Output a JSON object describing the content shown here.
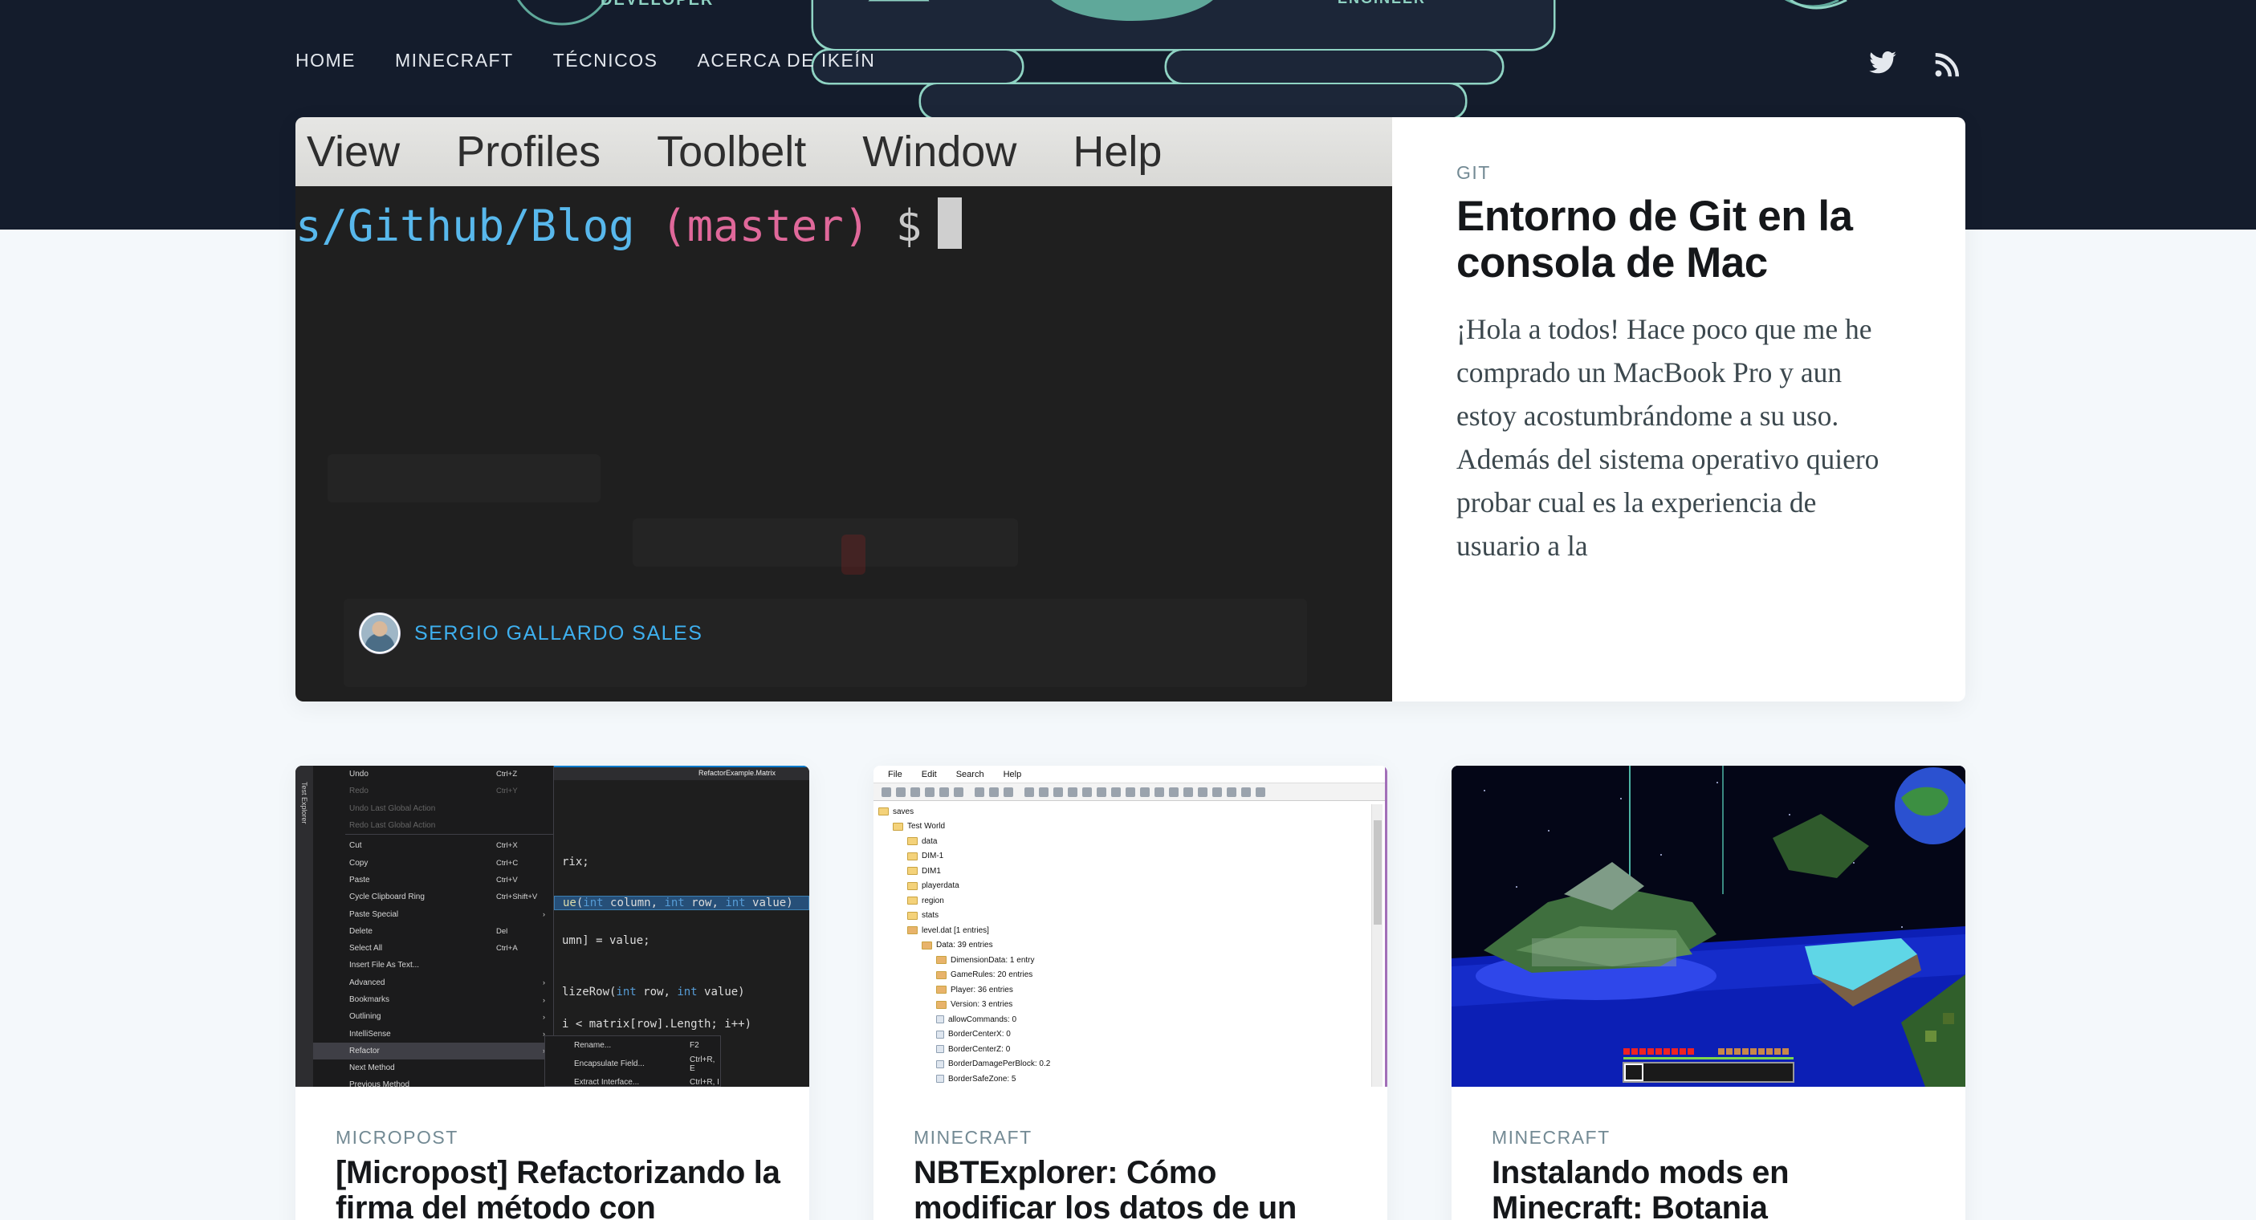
{
  "nav": {
    "items": [
      "Home",
      "Minecraft",
      "Técnicos",
      "Acerca de Ikeín"
    ]
  },
  "social": {
    "twitter_icon": "twitter-icon",
    "rss_icon": "rss-icon"
  },
  "header_graphic": {
    "left_text": "DEVELOPER",
    "right_text": "ENGINEER"
  },
  "featured": {
    "image": {
      "menu": [
        "View",
        "Profiles",
        "Toolbelt",
        "Window",
        "Help"
      ],
      "path": "s/Github/Blog",
      "branch": "(master)",
      "prompt": "$"
    },
    "tag": "Git",
    "title": "Entorno de Git en la consola de Mac",
    "excerpt": "¡Hola a todos! Hace poco que me he comprado un MacBook Pro y aun estoy acostumbrándome a su uso. Además del sistema operativo quiero probar cual es la experiencia de usuario a la",
    "author": "Sergio Gallardo Sales"
  },
  "cards": [
    {
      "tag": "Micropost",
      "title": "[Micropost] Refactorizando la firma del método con",
      "image": {
        "tab": "RefactorExample.Matrix",
        "sidebar": "Test Explorer",
        "menu": [
          {
            "label": "Undo",
            "key": "Ctrl+Z"
          },
          {
            "label": "Redo",
            "key": "Ctrl+Y",
            "dim": true
          },
          {
            "label": "Undo Last Global Action",
            "key": "",
            "dim": true
          },
          {
            "label": "Redo Last Global Action",
            "key": "",
            "dim": true
          },
          {
            "label": "",
            "key": "",
            "sep": true
          },
          {
            "label": "Cut",
            "key": "Ctrl+X"
          },
          {
            "label": "Copy",
            "key": "Ctrl+C"
          },
          {
            "label": "Paste",
            "key": "Ctrl+V"
          },
          {
            "label": "Cycle Clipboard Ring",
            "key": "Ctrl+Shift+V"
          },
          {
            "label": "Paste Special",
            "key": "",
            "arrow": true
          },
          {
            "label": "Delete",
            "key": "Del"
          },
          {
            "label": "Select All",
            "key": "Ctrl+A"
          },
          {
            "label": "Insert File As Text...",
            "key": ""
          },
          {
            "label": "Advanced",
            "key": "",
            "arrow": true
          },
          {
            "label": "Bookmarks",
            "key": "",
            "arrow": true
          },
          {
            "label": "Outlining",
            "key": "",
            "arrow": true
          },
          {
            "label": "IntelliSense",
            "key": "",
            "arrow": true
          },
          {
            "label": "Refactor",
            "key": "",
            "arrow": true,
            "sel": true
          },
          {
            "label": "Next Method",
            "key": ""
          },
          {
            "label": "Previous Method",
            "key": ""
          }
        ],
        "submenu": [
          {
            "label": "Rename...",
            "key": "F2"
          },
          {
            "label": "Encapsulate Field...",
            "key": "Ctrl+R, E"
          },
          {
            "label": "Extract Interface...",
            "key": "Ctrl+R, I"
          }
        ],
        "code": [
          "rix;",
          "ue(int column, int row, int value)",
          "umn] = value;",
          "lizeRow(int row, int value)",
          " i < matrix[row].Length; i++)"
        ]
      }
    },
    {
      "tag": "Minecraft",
      "title": "NBTExplorer: Cómo modificar los datos de un",
      "image": {
        "menu": [
          "File",
          "Edit",
          "Search",
          "Help"
        ],
        "tree": [
          {
            "label": "saves",
            "depth": 0,
            "type": "folder"
          },
          {
            "label": "Test World",
            "depth": 1,
            "type": "folder"
          },
          {
            "label": "data",
            "depth": 2,
            "type": "folder"
          },
          {
            "label": "DIM-1",
            "depth": 2,
            "type": "folder"
          },
          {
            "label": "DIM1",
            "depth": 2,
            "type": "folder"
          },
          {
            "label": "playerdata",
            "depth": 2,
            "type": "folder"
          },
          {
            "label": "region",
            "depth": 2,
            "type": "folder"
          },
          {
            "label": "stats",
            "depth": 2,
            "type": "folder"
          },
          {
            "label": "level.dat [1 entries]",
            "depth": 2,
            "type": "file"
          },
          {
            "label": "Data: 39 entries",
            "depth": 3,
            "type": "tag"
          },
          {
            "label": "DimensionData: 1 entry",
            "depth": 4,
            "type": "tag"
          },
          {
            "label": "GameRules: 20 entries",
            "depth": 4,
            "type": "tag"
          },
          {
            "label": "Player: 36 entries",
            "depth": 4,
            "type": "tag"
          },
          {
            "label": "Version: 3 entries",
            "depth": 4,
            "type": "tag"
          },
          {
            "label": "allowCommands: 0",
            "depth": 4,
            "type": "value"
          },
          {
            "label": "BorderCenterX: 0",
            "depth": 4,
            "type": "value"
          },
          {
            "label": "BorderCenterZ: 0",
            "depth": 4,
            "type": "value"
          },
          {
            "label": "BorderDamagePerBlock: 0.2",
            "depth": 4,
            "type": "value"
          },
          {
            "label": "BorderSafeZone: 5",
            "depth": 4,
            "type": "value"
          }
        ]
      }
    },
    {
      "tag": "Minecraft",
      "title": "Instalando mods en Minecraft: Botania",
      "image": {}
    }
  ]
}
